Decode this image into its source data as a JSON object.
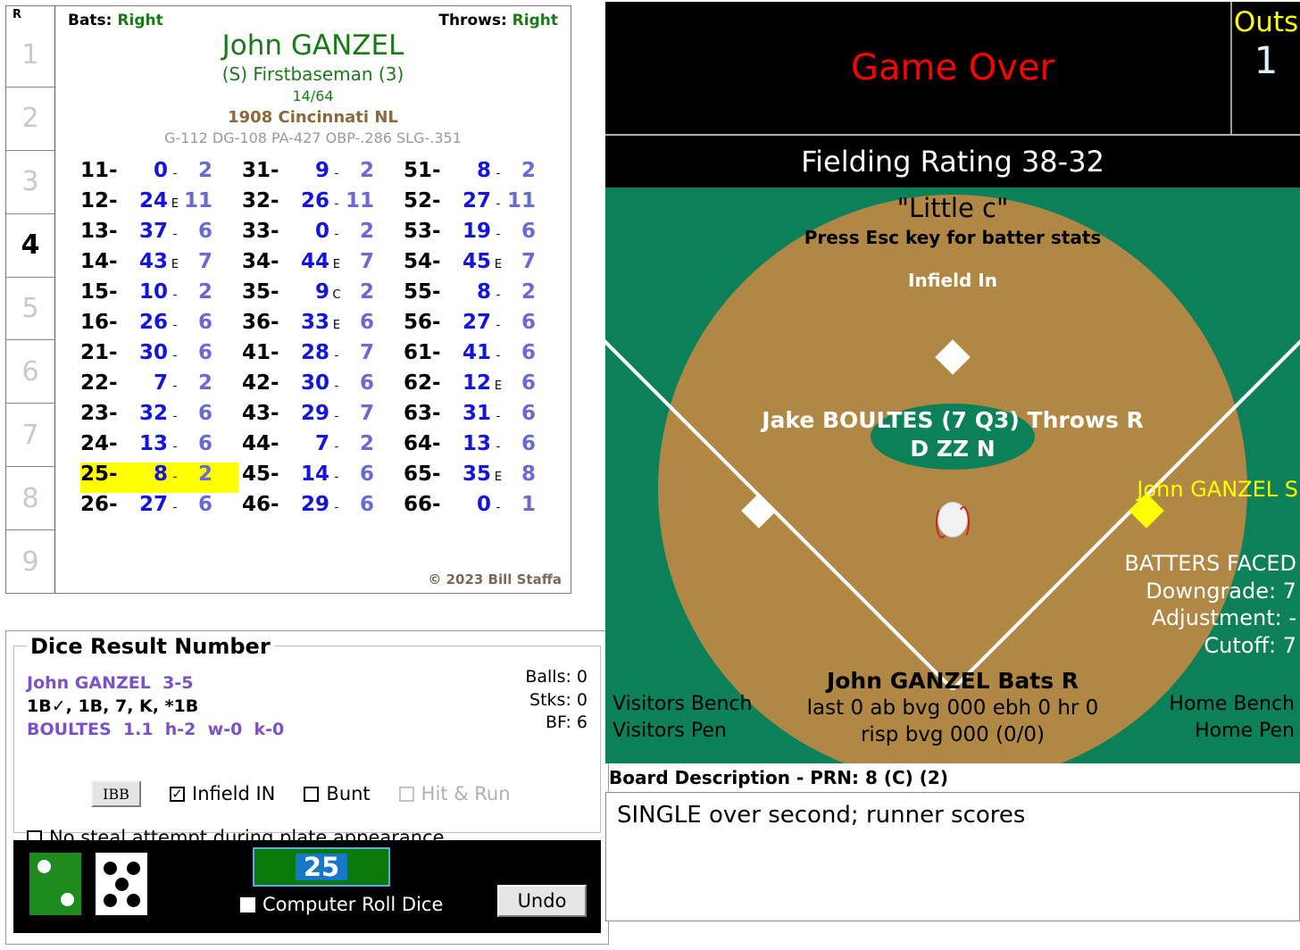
{
  "batter_card": {
    "innings_header": "R",
    "innings": [
      {
        "label": "1",
        "active": false
      },
      {
        "label": "2",
        "active": false
      },
      {
        "label": "3",
        "active": false
      },
      {
        "label": "4",
        "active": true
      },
      {
        "label": "5",
        "active": false
      },
      {
        "label": "6",
        "active": false
      },
      {
        "label": "7",
        "active": false
      },
      {
        "label": "8",
        "active": false
      },
      {
        "label": "9",
        "active": false
      }
    ],
    "bats_label": "Bats:",
    "bats_value": "Right",
    "throws_label": "Throws:",
    "throws_value": "Right",
    "player_name": "John GANZEL",
    "position": "(S) Firstbaseman (3)",
    "card_number": "14/64",
    "team": "1908 Cincinnati NL",
    "stat_line": "G-112 DG-108 PA-427 OBP-.286 SLG-.351",
    "copyright": "© 2023 Bill Staffa",
    "dice_columns": [
      [
        {
          "key": "11-",
          "result": "0",
          "flag": "-",
          "sub": "2",
          "highlight": false
        },
        {
          "key": "12-",
          "result": "24",
          "flag": "E",
          "sub": "11",
          "highlight": false
        },
        {
          "key": "13-",
          "result": "37",
          "flag": "-",
          "sub": "6",
          "highlight": false
        },
        {
          "key": "14-",
          "result": "43",
          "flag": "E",
          "sub": "7",
          "highlight": false
        },
        {
          "key": "15-",
          "result": "10",
          "flag": "-",
          "sub": "2",
          "highlight": false
        },
        {
          "key": "16-",
          "result": "26",
          "flag": "-",
          "sub": "6",
          "highlight": false
        },
        {
          "key": "21-",
          "result": "30",
          "flag": "-",
          "sub": "6",
          "highlight": false
        },
        {
          "key": "22-",
          "result": "7",
          "flag": "-",
          "sub": "2",
          "highlight": false
        },
        {
          "key": "23-",
          "result": "32",
          "flag": "-",
          "sub": "6",
          "highlight": false
        },
        {
          "key": "24-",
          "result": "13",
          "flag": "-",
          "sub": "6",
          "highlight": false
        },
        {
          "key": "25-",
          "result": "8",
          "flag": "-",
          "sub": "2",
          "highlight": true
        },
        {
          "key": "26-",
          "result": "27",
          "flag": "-",
          "sub": "6",
          "highlight": false
        }
      ],
      [
        {
          "key": "31-",
          "result": "9",
          "flag": "-",
          "sub": "2",
          "highlight": false
        },
        {
          "key": "32-",
          "result": "26",
          "flag": "-",
          "sub": "11",
          "highlight": false
        },
        {
          "key": "33-",
          "result": "0",
          "flag": "-",
          "sub": "2",
          "highlight": false
        },
        {
          "key": "34-",
          "result": "44",
          "flag": "E",
          "sub": "7",
          "highlight": false
        },
        {
          "key": "35-",
          "result": "9",
          "flag": "C",
          "sub": "2",
          "highlight": false
        },
        {
          "key": "36-",
          "result": "33",
          "flag": "E",
          "sub": "6",
          "highlight": false
        },
        {
          "key": "41-",
          "result": "28",
          "flag": "-",
          "sub": "7",
          "highlight": false
        },
        {
          "key": "42-",
          "result": "30",
          "flag": "-",
          "sub": "6",
          "highlight": false
        },
        {
          "key": "43-",
          "result": "29",
          "flag": "-",
          "sub": "7",
          "highlight": false
        },
        {
          "key": "44-",
          "result": "7",
          "flag": "-",
          "sub": "2",
          "highlight": false
        },
        {
          "key": "45-",
          "result": "14",
          "flag": "-",
          "sub": "6",
          "highlight": false
        },
        {
          "key": "46-",
          "result": "29",
          "flag": "-",
          "sub": "6",
          "highlight": false
        }
      ],
      [
        {
          "key": "51-",
          "result": "8",
          "flag": "-",
          "sub": "2",
          "highlight": false
        },
        {
          "key": "52-",
          "result": "27",
          "flag": "-",
          "sub": "11",
          "highlight": false
        },
        {
          "key": "53-",
          "result": "19",
          "flag": "-",
          "sub": "6",
          "highlight": false
        },
        {
          "key": "54-",
          "result": "45",
          "flag": "E",
          "sub": "7",
          "highlight": false
        },
        {
          "key": "55-",
          "result": "8",
          "flag": "-",
          "sub": "2",
          "highlight": false
        },
        {
          "key": "56-",
          "result": "27",
          "flag": "-",
          "sub": "6",
          "highlight": false
        },
        {
          "key": "61-",
          "result": "41",
          "flag": "-",
          "sub": "6",
          "highlight": false
        },
        {
          "key": "62-",
          "result": "12",
          "flag": "E",
          "sub": "6",
          "highlight": false
        },
        {
          "key": "63-",
          "result": "31",
          "flag": "-",
          "sub": "6",
          "highlight": false
        },
        {
          "key": "64-",
          "result": "13",
          "flag": "-",
          "sub": "6",
          "highlight": false
        },
        {
          "key": "65-",
          "result": "35",
          "flag": "E",
          "sub": "8",
          "highlight": false
        },
        {
          "key": "66-",
          "result": "0",
          "flag": "-",
          "sub": "1",
          "highlight": false
        }
      ]
    ]
  },
  "dice_panel": {
    "group_title": "Dice Result Number",
    "batter_line": "John GANZEL  3-5",
    "result_line": "1B✓, 1B, 7, K, *1B",
    "pitcher_line": "BOULTES  1.1  h-2  w-0  k-0",
    "counts": {
      "balls": "Balls: 0",
      "strikes": "Stks: 0",
      "bf": "BF: 6"
    },
    "ibb_label": "IBB",
    "checkboxes": [
      {
        "label": "Infield IN",
        "checked": true,
        "disabled": false,
        "mark": "✓"
      },
      {
        "label": "Bunt",
        "checked": false,
        "disabled": false,
        "mark": ""
      },
      {
        "label": "Hit & Run",
        "checked": false,
        "disabled": true,
        "mark": ""
      }
    ],
    "no_steal": {
      "label": "No steal attempt during plate appearance",
      "checked": false
    },
    "dice": {
      "green_die_value": 2,
      "white_die_value": 5,
      "roll_number": "25",
      "computer_roll_label": "Computer Roll Dice",
      "computer_roll_checked": false,
      "undo_label": "Undo"
    }
  },
  "scoreboard": {
    "status": "Game Over",
    "outs_label": "Outs",
    "outs_value": "1",
    "fielding_rating": "Fielding Rating 38-32"
  },
  "field": {
    "park_name": "\"Little c\"",
    "esc_hint": "Press Esc key for batter stats",
    "defense_state": "Infield In",
    "pitcher": "Jake BOULTES (7 Q3) Throws R",
    "pitcher_ratings": "D ZZ N",
    "runner_first": "John GANZEL S",
    "batters_faced": {
      "title": "BATTERS FACED",
      "downgrade": "Downgrade: 7",
      "adjustment": "Adjustment: -",
      "cutoff": "Cutoff: 7"
    },
    "batter": "John GANZEL Bats R",
    "batter_stat1": "last 0 ab bvg 000 ebh 0 hr 0",
    "batter_stat2": "risp bvg 000 (0/0)",
    "visitors_bench": "Visitors Bench",
    "visitors_pen": "Visitors Pen",
    "home_bench": "Home Bench",
    "home_pen": "Home Pen"
  },
  "board_description": {
    "label": "Board Description - PRN: 8 (C) (2)",
    "text": "SINGLE over second; runner scores"
  },
  "colors": {
    "field_green": "#0c8159",
    "dirt_brown": "#b08744",
    "highlight_yellow": "#ffff00",
    "result_blue": "#1414dc",
    "sub_blue": "#6a6ad2",
    "name_green": "#1a7a1a",
    "purple": "#7b52c7",
    "alert_red": "#ff0000"
  }
}
